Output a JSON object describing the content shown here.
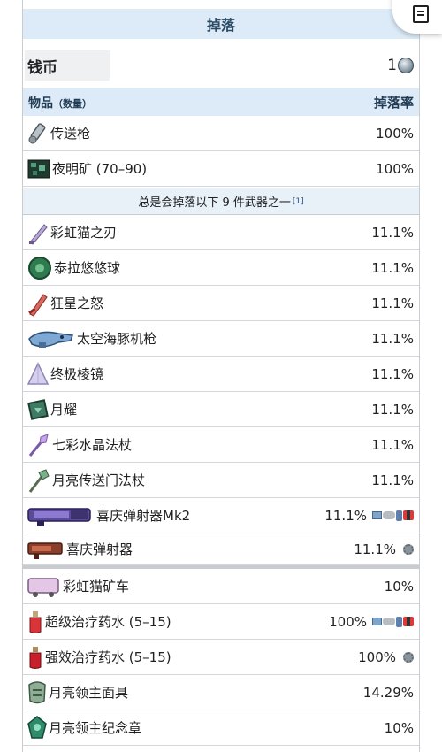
{
  "drops_header": "掉落",
  "coins": {
    "label": "钱币",
    "value": "1"
  },
  "columns": {
    "item": "物品",
    "qty": "（数量）",
    "rate": "掉落率"
  },
  "guaranteed": [
    {
      "name": "传送枪",
      "rate": "100%",
      "icon": "portal-gun-icon"
    },
    {
      "name": "夜明矿 (70–90)",
      "rate": "100%",
      "icon": "luminite-ore-icon"
    }
  ],
  "weapon_header": {
    "text": "总是会掉落以下 9 件武器之一",
    "ref": "[1]"
  },
  "weapons": [
    {
      "name": "彩虹猫之刃",
      "rate": "11.1%",
      "icon": "meowmere-icon"
    },
    {
      "name": "泰拉悠悠球",
      "rate": "11.1%",
      "icon": "terrarian-yoyo-icon"
    },
    {
      "name": "狂星之怒",
      "rate": "11.1%",
      "icon": "star-wrath-icon"
    },
    {
      "name": "太空海豚机枪",
      "rate": "11.1%",
      "icon": "sdmg-icon"
    },
    {
      "name": "终极棱镜",
      "rate": "11.1%",
      "icon": "last-prism-icon"
    },
    {
      "name": "月耀",
      "rate": "11.1%",
      "icon": "lunar-flare-icon"
    },
    {
      "name": "七彩水晶法杖",
      "rate": "11.1%",
      "icon": "rainbow-crystal-staff-icon"
    },
    {
      "name": "月亮传送门法杖",
      "rate": "11.1%",
      "icon": "lunar-portal-staff-icon"
    },
    {
      "name": "喜庆弹射器Mk2",
      "rate": "11.1%",
      "icon": "celebration-mk2-icon",
      "platforms": "desktop-console-mobile-switch"
    },
    {
      "name": "喜庆弹射器",
      "rate": "11.1%",
      "icon": "celebration-icon",
      "platforms": "old-gen"
    }
  ],
  "extras": [
    {
      "name": "彩虹猫矿车",
      "rate": "10%",
      "icon": "meowmere-minecart-icon"
    },
    {
      "name": "超级治疗药水 (5–15)",
      "rate": "100%",
      "icon": "super-healing-potion-icon",
      "platforms": "desktop-console-mobile-switch"
    },
    {
      "name": "强效治疗药水 (5–15)",
      "rate": "100%",
      "icon": "greater-healing-potion-icon",
      "platforms": "old-gen"
    },
    {
      "name": "月亮领主面具",
      "rate": "14.29%",
      "icon": "moon-lord-mask-icon"
    },
    {
      "name": "月亮领主纪念章",
      "rate": "10%",
      "icon": "moon-lord-relic-icon"
    }
  ],
  "colors": {
    "header_bg": "#dcebf7",
    "header_text": "#2b4a63",
    "border": "#c8ccd1"
  }
}
